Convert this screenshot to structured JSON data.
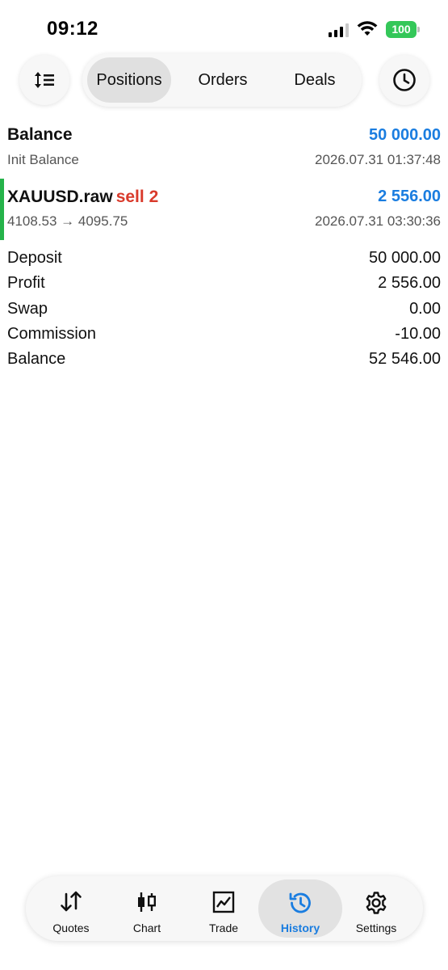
{
  "status_bar": {
    "time": "09:12",
    "battery": "100"
  },
  "toolbar": {
    "sort_icon": "sort-icon",
    "history_filter_icon": "clock-icon",
    "segments": [
      "Positions",
      "Orders",
      "Deals"
    ],
    "selected_segment": "Positions"
  },
  "balance_entry": {
    "title": "Balance",
    "amount": "50 000.00",
    "comment": "Init Balance",
    "datetime": "2026.07.31 01:37:48"
  },
  "deal": {
    "symbol": "XAUUSD.raw",
    "side": "sell 2",
    "profit": "2 556.00",
    "prices": "4108.53 → 4095.75",
    "datetime": "2026.07.31 03:30:36"
  },
  "summary": [
    {
      "label": "Deposit",
      "value": "50 000.00"
    },
    {
      "label": "Profit",
      "value": "2 556.00"
    },
    {
      "label": "Swap",
      "value": "0.00"
    },
    {
      "label": "Commission",
      "value": "-10.00"
    },
    {
      "label": "Balance",
      "value": "52 546.00"
    }
  ],
  "tabbar": {
    "items": [
      {
        "label": "Quotes",
        "icon": "quotes-icon"
      },
      {
        "label": "Chart",
        "icon": "candlestick-icon"
      },
      {
        "label": "Trade",
        "icon": "trade-chart-icon"
      },
      {
        "label": "History",
        "icon": "history-icon"
      },
      {
        "label": "Settings",
        "icon": "gear-icon"
      }
    ],
    "active": "History"
  },
  "colors": {
    "accent_blue": "#1a7de0",
    "sell_red": "#d93a2b",
    "deal_bar_green": "#25b34a",
    "battery_green": "#34c759"
  }
}
